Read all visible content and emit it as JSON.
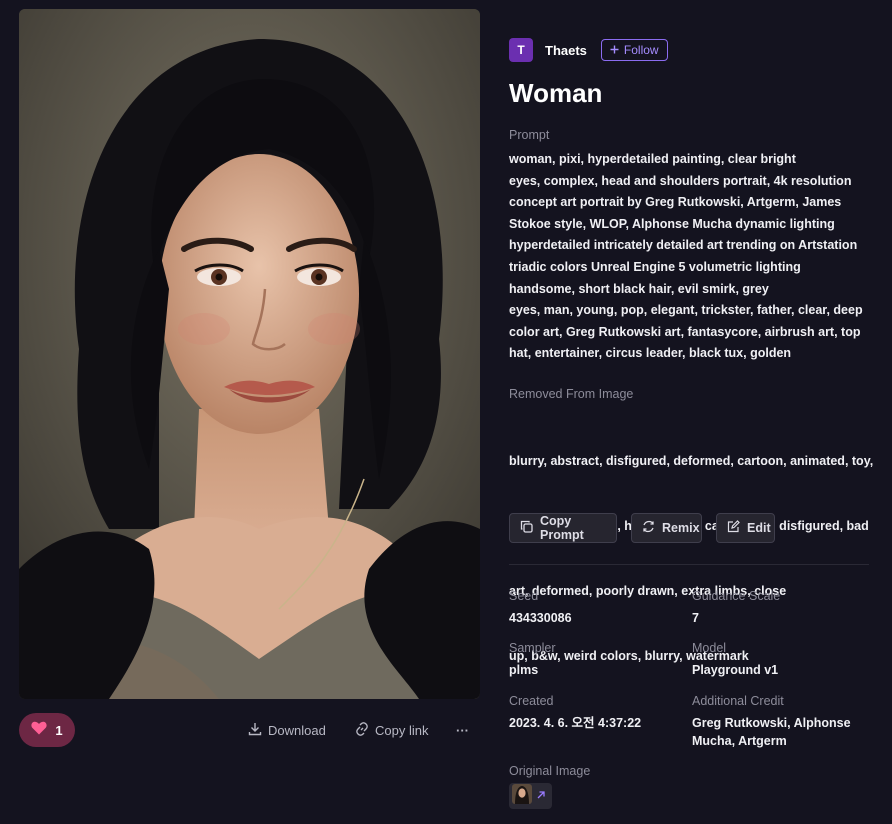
{
  "artwork": {
    "image_alt": "portrait of a woman with black hair"
  },
  "actions": {
    "like_count": "1",
    "download_label": "Download",
    "copy_link_label": "Copy link",
    "more_label": "···"
  },
  "author": {
    "initial": "T",
    "name": "Thaets",
    "follow_label": "Follow"
  },
  "title": "Woman",
  "prompt": {
    "label": "Prompt",
    "lines": [
      "woman, pixi, hyperdetailed painting, clear bright",
      "eyes, complex, head and shoulders portrait, 4k resolution",
      "concept art portrait by Greg Rutkowski, Artgerm, James",
      "Stokoe style, WLOP, Alphonse Mucha dynamic lighting",
      "hyperdetailed intricately detailed art trending on Artstation",
      "triadic colors Unreal Engine 5 volumetric lighting",
      "handsome, short black hair, evil smirk, grey",
      "eyes, man, young, pop, elegant, trickster, father, clear, deep",
      "color art, Greg Rutkowski art, fantasycore, airbrush art, top",
      "hat, entertainer, circus leader, black tux, golden"
    ]
  },
  "negative": {
    "label": "Removed From Image",
    "lines": [
      "blurry, abstract, disfigured, deformed, cartoon, animated, toy,",
      " figure, framed, 3d, hands, nude, cartoon, 3d, disfigured, bad",
      "art, deformed, poorly drawn, extra limbs, close",
      "up, b&w, weird colors, blurry, watermark"
    ]
  },
  "buttons": {
    "copy_prompt": "Copy Prompt",
    "remix": "Remix",
    "edit": "Edit"
  },
  "meta": {
    "seed_label": "Seed",
    "seed": "434330086",
    "guidance_label": "Guidance Scale",
    "guidance": "7",
    "sampler_label": "Sampler",
    "sampler": "plms",
    "model_label": "Model",
    "model": "Playground v1",
    "created_label": "Created",
    "created": "2023. 4. 6. 오전 4:37:22",
    "credit_label": "Additional Credit",
    "credit_line1": "Greg Rutkowski, Alphonse",
    "credit_line2": "Mucha, Artgerm"
  },
  "original_image": {
    "label": "Original Image"
  },
  "colors": {
    "background": "#14131f",
    "accent": "#8b6cf0",
    "like": "#6d2744",
    "avatar": "#6b2fb0"
  },
  "icons": [
    "heart-icon",
    "download-icon",
    "link-icon",
    "more-icon",
    "plus-icon",
    "copy-icon",
    "remix-icon",
    "edit-icon",
    "external-arrow-icon"
  ]
}
